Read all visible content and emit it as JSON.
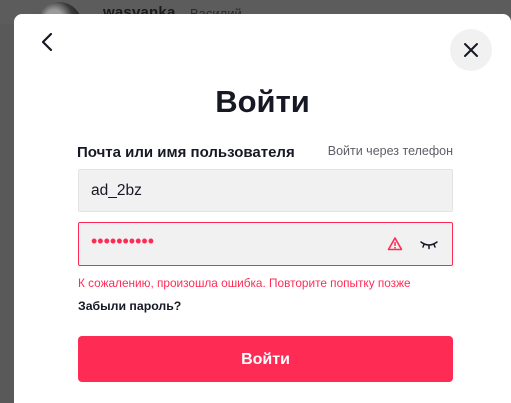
{
  "background": {
    "username": "wasvanka",
    "subname": "Василий"
  },
  "modal": {
    "title": "Войти",
    "field_label": "Почта или имя пользователя",
    "phone_link": "Войти через телефон",
    "username_value": "ad_2bz",
    "password_mask": "••••••••••",
    "error_message": "К сожалению, произошла ошибка. Повторите попытку позже",
    "forgot_password": "Забыли пароль?",
    "submit_label": "Войти"
  },
  "icons": {
    "back": "chevron-left-icon",
    "close": "close-icon",
    "warning": "warning-icon",
    "eye": "eye-closed-icon"
  },
  "colors": {
    "accent": "#fe2c55",
    "text": "#161823",
    "input_bg": "#f1f1f2",
    "overlay": "#595959"
  }
}
